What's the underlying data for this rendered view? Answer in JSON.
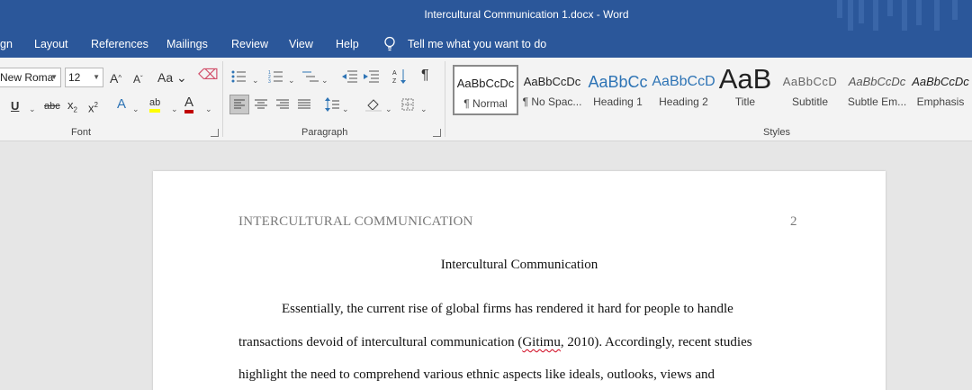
{
  "titlebar": {
    "title": "Intercultural Communication 1.docx  -  Word"
  },
  "menu": {
    "items": [
      "gn",
      "Layout",
      "References",
      "Mailings",
      "Review",
      "View",
      "Help"
    ],
    "tell_me": "Tell me what you want to do"
  },
  "ribbon": {
    "font": {
      "name": "New Roma",
      "size": "12",
      "label": "Font",
      "grow": "A",
      "shrink": "A",
      "case": "Aa",
      "underline": "U",
      "strike": "abc",
      "subscript": "x",
      "superscript": "x",
      "text_effects": "A",
      "highlight": "ab",
      "font_color": "A"
    },
    "paragraph": {
      "label": "Paragraph",
      "pilcrow": "¶"
    },
    "styles": {
      "label": "Styles",
      "items": [
        {
          "sample": "AaBbCcDc",
          "label": "¶ Normal"
        },
        {
          "sample": "AaBbCcDc",
          "label": "¶ No Spac..."
        },
        {
          "sample": "AaBbCc",
          "label": "Heading 1"
        },
        {
          "sample": "AaBbCcD",
          "label": "Heading 2"
        },
        {
          "sample": "AaB",
          "label": "Title"
        },
        {
          "sample": "AaBbCcD",
          "label": "Subtitle"
        },
        {
          "sample": "AaBbCcDc",
          "label": "Subtle Em..."
        },
        {
          "sample": "AaBbCcDc",
          "label": "Emphasis"
        }
      ]
    }
  },
  "document": {
    "header_left": "INTERCULTURAL COMMUNICATION",
    "page_number": "2",
    "title": "Intercultural Communication",
    "lines": [
      "Essentially, the current rise of global firms has rendered it hard for people to handle",
      "transactions devoid of intercultural communication (",
      "Gitimu",
      ", 2010). Accordingly, recent studies",
      "highlight the need to comprehend various ethnic aspects like ideals, outlooks, views and"
    ]
  },
  "colors": {
    "titlebar": "#2b579a",
    "ribbon": "#f3f3f3",
    "heading_blue": "#2e74b5",
    "spell_error": "#d0021b",
    "highlight_yellow": "#ffff00",
    "font_color_red": "#c00000"
  }
}
